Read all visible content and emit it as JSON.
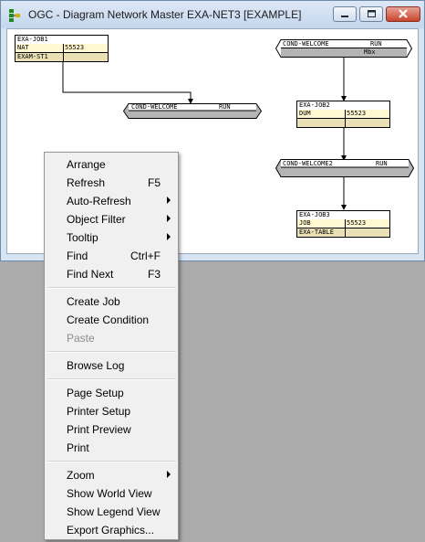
{
  "window": {
    "title": "OGC - Diagram Network Master EXA-NET3 [EXAMPLE]"
  },
  "icons": {
    "app": "network-diagram-icon",
    "minimize": "minimize-icon",
    "maximize": "maximize-icon",
    "close": "close-icon",
    "submenu": "chevron-right-icon"
  },
  "colors": {
    "title_bar": "#c4d7ee",
    "window_frame": "#d6e4f3",
    "close_button": "#c8452e",
    "job_row": "#fff8d0",
    "job_footer": "#e9e0b6",
    "condition": "#b4b4b4",
    "desktop": "#ababab",
    "menu_bg": "#f0f0f0"
  },
  "diagram": {
    "jobs": {
      "job1": {
        "name": "EXA-JOB1",
        "type": "NAT",
        "id": "55523",
        "condition": "EXAM-ST1"
      },
      "job2": {
        "name": "EXA-JOB2",
        "type": "DUM",
        "id": "55523",
        "condition": ""
      },
      "job3": {
        "name": "EXA-JOB3",
        "type": "JOB",
        "id": "55523",
        "condition": "EXA-TABLE"
      }
    },
    "conditions": {
      "top_right": {
        "name": "COND-WELCOME",
        "status": "RUN",
        "sub": "Mbx"
      },
      "middle_left": {
        "name": "COND-WELCOME",
        "status": "RUN"
      },
      "middle_right": {
        "name": "COND-WELCOME2",
        "status": "RUN"
      }
    }
  },
  "context_menu": {
    "arrange": "Arrange",
    "refresh": {
      "label": "Refresh",
      "shortcut": "F5"
    },
    "auto_refresh": "Auto-Refresh",
    "object_filter": "Object Filter",
    "tooltip": "Tooltip",
    "find": {
      "label": "Find",
      "shortcut": "Ctrl+F"
    },
    "find_next": {
      "label": "Find Next",
      "shortcut": "F3"
    },
    "create_job": "Create Job",
    "create_condition": "Create Condition",
    "paste": "Paste",
    "browse_log": "Browse Log",
    "page_setup": "Page Setup",
    "printer_setup": "Printer Setup",
    "print_preview": "Print Preview",
    "print": "Print",
    "zoom": "Zoom",
    "show_world_view": "Show World View",
    "show_legend_view": "Show Legend View",
    "export_graphics": "Export Graphics..."
  }
}
